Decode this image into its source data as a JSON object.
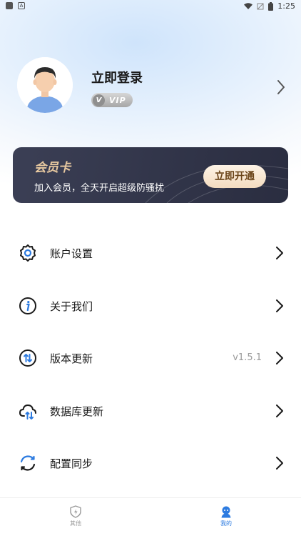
{
  "status_bar": {
    "time": "1:25"
  },
  "profile": {
    "login_label": "立即登录",
    "vip_badge": "VIP"
  },
  "member_card": {
    "title": "会员卡",
    "subtitle": "加入会员，全天开启超级防骚扰",
    "button_label": "立即开通"
  },
  "menu": [
    {
      "label": "账户设置",
      "value": "",
      "icon": "gear-icon"
    },
    {
      "label": "关于我们",
      "value": "",
      "icon": "info-icon"
    },
    {
      "label": "版本更新",
      "value": "v1.5.1",
      "icon": "update-arrows-icon"
    },
    {
      "label": "数据库更新",
      "value": "",
      "icon": "cloud-sync-icon"
    },
    {
      "label": "配置同步",
      "value": "",
      "icon": "sync-circle-icon"
    }
  ],
  "tabs": [
    {
      "label": "其他",
      "icon": "shield-bolt-icon",
      "active": false
    },
    {
      "label": "我的",
      "icon": "person-icon",
      "active": true
    }
  ],
  "colors": {
    "accent": "#2d7be0",
    "card_bg": "#2f3247",
    "card_title": "#e8c9a0"
  }
}
